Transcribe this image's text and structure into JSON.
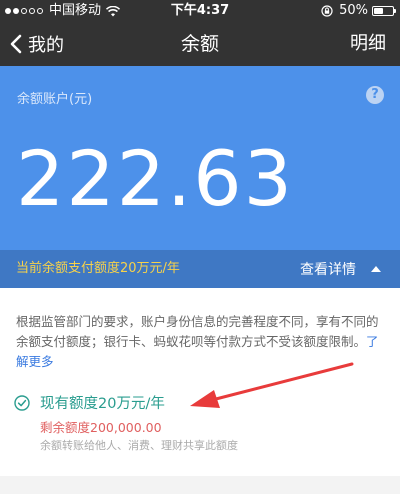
{
  "status_bar": {
    "carrier": "中国移动",
    "time": "下午4:37",
    "battery": "50%"
  },
  "nav": {
    "back_label": "我的",
    "title": "余额",
    "detail_label": "明细"
  },
  "balance": {
    "account_label": "余额账户(元)",
    "help_symbol": "?",
    "amount": "222.63"
  },
  "quota_strip": {
    "text": "当前余额支付额度20万元/年",
    "view_details": "查看详情"
  },
  "info": {
    "policy_text": "根据监管部门的要求，账户身份信息的完善程度不同，享有不同的余额支付额度；银行卡、蚂蚁花呗等付款方式不受该额度限制。",
    "learn_more": "了解更多",
    "current_quota": "现有额度20万元/年",
    "remaining_quota": "剩余额度200,000.00",
    "usage_note": "余额转账给他人、消费、理财共享此额度"
  },
  "colors": {
    "dark_bar": "#333333",
    "panel_blue": "#4d91ea",
    "strip_blue": "#3f78c4",
    "quota_yellow": "#f7d24a",
    "accent_teal": "#2a9d8f",
    "remaining_red": "#e06060",
    "link_blue": "#3b7be0",
    "arrow_red": "#e83b3b"
  },
  "icons": {
    "signal": "signal-dots-icon",
    "wifi": "wifi-icon",
    "lock": "rotation-lock-icon",
    "battery": "battery-icon",
    "back": "chevron-left-icon",
    "help": "question-mark-icon",
    "caret": "caret-up-icon",
    "check": "check-circle-icon",
    "arrow": "annotation-arrow-icon"
  },
  "battery_level": 0.5
}
